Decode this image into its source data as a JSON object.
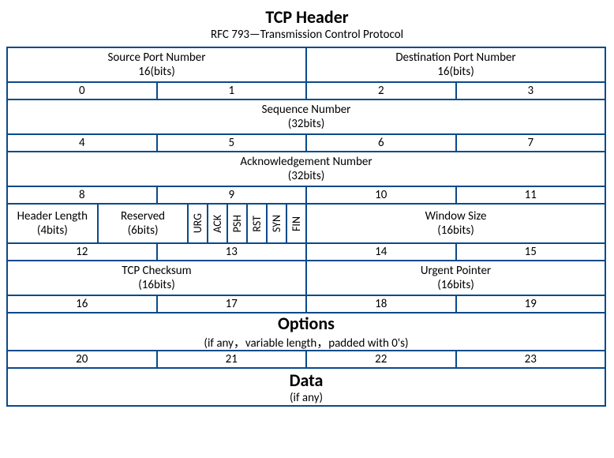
{
  "title": "TCP Header",
  "subtitle": "RFC 793—Transmission Control Protocol",
  "fields": {
    "src_port": {
      "name": "Source Port Number",
      "bits": "16(bits)"
    },
    "dst_port": {
      "name": "Destination Port Number",
      "bits": "16(bits)"
    },
    "seq": {
      "name": "Sequence Number",
      "bits": "(32bits)"
    },
    "ack": {
      "name": "Acknowledgement Number",
      "bits": "(32bits)"
    },
    "hlen": {
      "name": "Header Length",
      "bits": "(4bits)"
    },
    "resv": {
      "name": "Reserved",
      "bits": "(6bits)"
    },
    "flags": [
      "URG",
      "ACK",
      "PSH",
      "RST",
      "SYN",
      "FIN"
    ],
    "win": {
      "name": "Window Size",
      "bits": "(16bits)"
    },
    "chk": {
      "name": "TCP Checksum",
      "bits": "(16bits)"
    },
    "urg": {
      "name": "Urgent Pointer",
      "bits": "(16bits)"
    },
    "opts": {
      "name": "Options",
      "note": "(if any，variable length，padded with 0's)"
    },
    "data": {
      "name": "Data",
      "note": "(if any)"
    }
  },
  "bytes": [
    "0",
    "1",
    "2",
    "3",
    "4",
    "5",
    "6",
    "7",
    "8",
    "9",
    "10",
    "11",
    "12",
    "13",
    "14",
    "15",
    "16",
    "17",
    "18",
    "19",
    "20",
    "21",
    "22",
    "23"
  ]
}
